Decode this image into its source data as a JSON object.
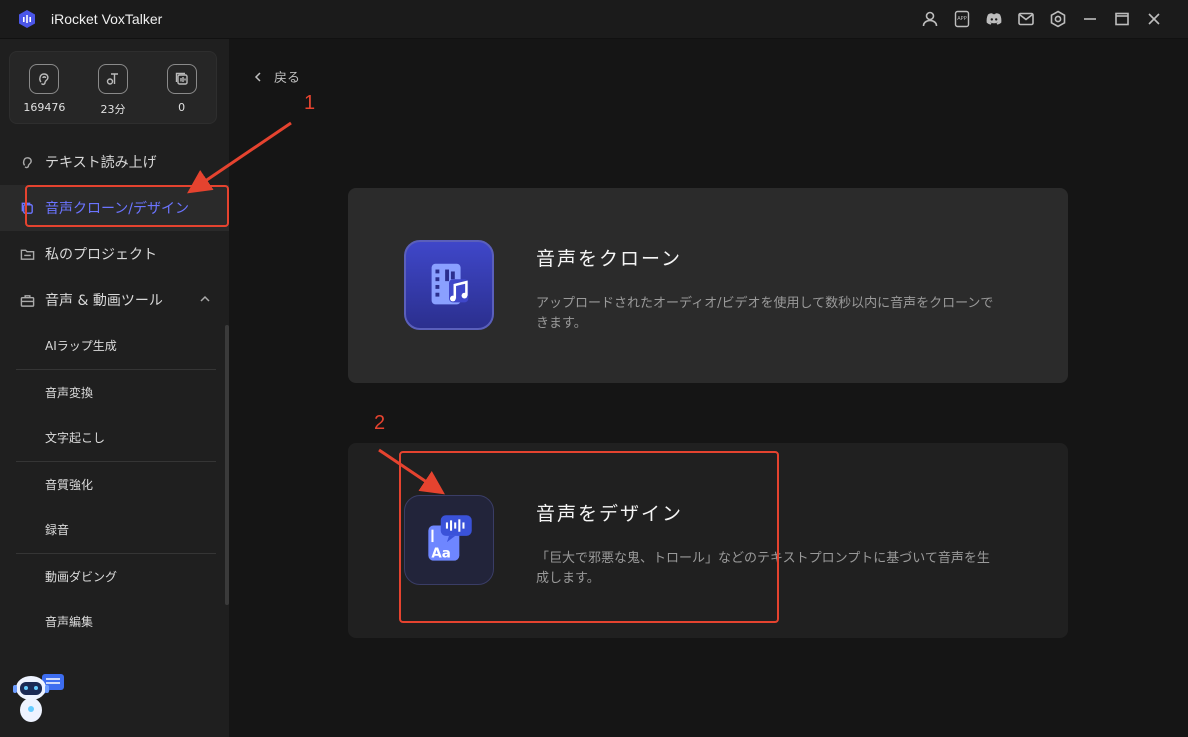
{
  "app": {
    "title": "iRocket VoxTalker"
  },
  "titlebar_icons": [
    "user-icon",
    "app-icon",
    "discord-icon",
    "mail-icon",
    "settings-icon",
    "minimize-icon",
    "maximize-icon",
    "close-icon"
  ],
  "stats": [
    {
      "icon": "ear-icon",
      "value": "169476"
    },
    {
      "icon": "text-voice-icon",
      "value": "23分"
    },
    {
      "icon": "clone-icon",
      "value": "0"
    }
  ],
  "sidebar": {
    "items": [
      {
        "label": "テキスト読み上げ"
      },
      {
        "label": "音声クローン/デザイン"
      },
      {
        "label": "私のプロジェクト"
      },
      {
        "label": "音声 & 動画ツール"
      }
    ],
    "sub_items": [
      {
        "label": "AIラップ生成"
      },
      {
        "label": "音声変換"
      },
      {
        "label": "文字起こし"
      },
      {
        "label": "音質強化"
      },
      {
        "label": "録音"
      },
      {
        "label": "動画ダビング"
      },
      {
        "label": "音声編集"
      }
    ]
  },
  "main": {
    "back_label": "戻る",
    "cards": [
      {
        "title": "音声をクローン",
        "desc": "アップロードされたオーディオ/ビデオを使用して数秒以内に音声をクローンできます。"
      },
      {
        "title": "音声をデザイン",
        "desc": "「巨大で邪悪な鬼、トロール」などのテキストプロンプトに基づいて音声を生成します。"
      }
    ]
  },
  "annotations": {
    "n1": "1",
    "n2": "2",
    "color": "#e5432f"
  },
  "colors": {
    "accent": "#6b74ff",
    "annotation": "#e5432f"
  }
}
